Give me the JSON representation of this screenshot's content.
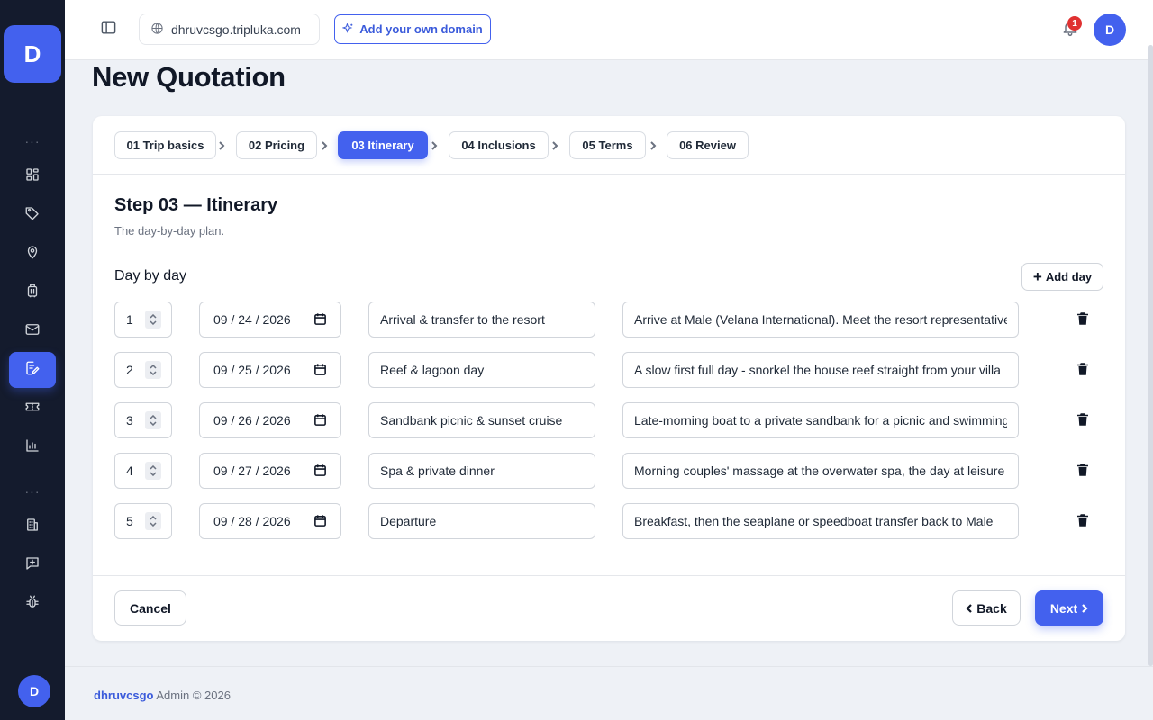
{
  "sidebar": {
    "brand_letter": "D",
    "section_dots_1": "···",
    "section_dots_2": "···",
    "avatar_letter": "D",
    "items": [
      {
        "icon": "dashboard-icon"
      },
      {
        "icon": "tag-icon"
      },
      {
        "icon": "map-pin-icon"
      },
      {
        "icon": "luggage-icon"
      },
      {
        "icon": "mail-icon"
      },
      {
        "icon": "edit-document-icon",
        "active": true
      },
      {
        "icon": "ticket-icon"
      },
      {
        "icon": "bar-chart-icon"
      },
      {
        "icon": "building-icon"
      },
      {
        "icon": "message-plus-icon"
      },
      {
        "icon": "bug-icon"
      }
    ]
  },
  "topbar": {
    "domain": "dhruvcsgo.tripluka.com",
    "add_domain_label": "Add your own domain",
    "notification_count": "1",
    "avatar_letter": "D"
  },
  "page": {
    "title": "New Quotation"
  },
  "steps": [
    {
      "label": "01 Trip basics"
    },
    {
      "label": "02 Pricing"
    },
    {
      "label": "03 Itinerary",
      "active": true
    },
    {
      "label": "04 Inclusions"
    },
    {
      "label": "05 Terms"
    },
    {
      "label": "06 Review"
    }
  ],
  "step_content": {
    "heading": "Step 03 — Itinerary",
    "subtitle": "The day-by-day plan.",
    "section_label": "Day by day",
    "add_day_label": "Add day",
    "add_day_plus": "+"
  },
  "days": [
    {
      "num": "1",
      "date": "09 / 24 / 2026",
      "title": "Arrival & transfer to the resort",
      "description": "Arrive at Male (Velana International). Meet the resort representative"
    },
    {
      "num": "2",
      "date": "09 / 25 / 2026",
      "title": "Reef & lagoon day",
      "description": "A slow first full day - snorkel the house reef straight from your villa"
    },
    {
      "num": "3",
      "date": "09 / 26 / 2026",
      "title": "Sandbank picnic & sunset cruise",
      "description": "Late-morning boat to a private sandbank for a picnic and swimming"
    },
    {
      "num": "4",
      "date": "09 / 27 / 2026",
      "title": "Spa & private dinner",
      "description": "Morning couples' massage at the overwater spa, the day at leisure"
    },
    {
      "num": "5",
      "date": "09 / 28 / 2026",
      "title": "Departure",
      "description": "Breakfast, then the seaplane or speedboat transfer back to Male"
    }
  ],
  "actions": {
    "cancel": "Cancel",
    "back": "Back",
    "next": "Next"
  },
  "footer": {
    "brand": "dhruvcsgo",
    "text": " Admin © 2026"
  },
  "colors": {
    "accent": "#4361ee",
    "sidebar_bg": "#141b2d",
    "page_bg": "#eef1f6",
    "badge": "#e03131"
  }
}
